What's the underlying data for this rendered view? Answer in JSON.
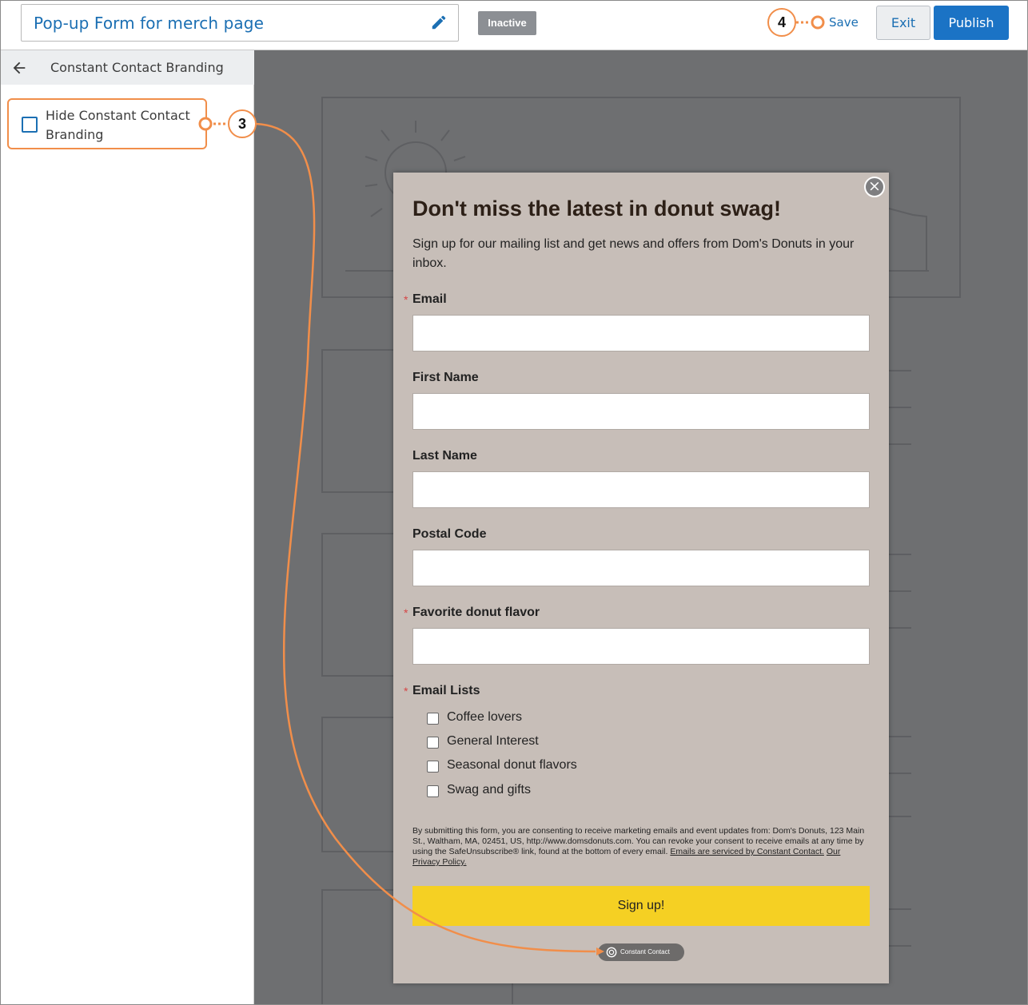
{
  "header": {
    "form_title": "Pop-up Form for merch page",
    "status": "Inactive",
    "save_label": "Save",
    "exit_label": "Exit",
    "publish_label": "Publish"
  },
  "sidebar": {
    "title": "Constant Contact Branding",
    "option_label": "Hide Constant Contact Branding",
    "option_checked": false
  },
  "popup": {
    "title": "Don't miss the latest in donut swag!",
    "description": "Sign up for our mailing list and get news and offers from Dom's Donuts in your inbox.",
    "required_marker": "*",
    "fields": [
      {
        "label": "Email",
        "required": true,
        "value": ""
      },
      {
        "label": "First Name",
        "required": false,
        "value": ""
      },
      {
        "label": "Last Name",
        "required": false,
        "value": ""
      },
      {
        "label": "Postal Code",
        "required": false,
        "value": ""
      },
      {
        "label": "Favorite donut flavor",
        "required": true,
        "value": ""
      }
    ],
    "lists_label": "Email Lists",
    "lists": [
      {
        "label": "Coffee lovers",
        "checked": false
      },
      {
        "label": "General Interest",
        "checked": false
      },
      {
        "label": "Seasonal donut flavors",
        "checked": false
      },
      {
        "label": "Swag and gifts",
        "checked": false
      }
    ],
    "consent_text": "By submitting this form, you are consenting to receive marketing emails and event updates from: Dom's Donuts, 123 Main St., Waltham, MA, 02451, US, http://www.domsdonuts.com. You can revoke your consent to receive emails at any time by using the SafeUnsubscribe® link, found at the bottom of every email.",
    "consent_link1": "Emails are serviced by Constant Contact.",
    "consent_link2": "Our Privacy Policy.",
    "signup_label": "Sign up!",
    "close_glyph": "×",
    "branding_badge": "Constant Contact"
  },
  "annotations": {
    "step3": "3",
    "step4": "4",
    "color": "#f18e4a"
  },
  "colors": {
    "accent": "#1b6fb3",
    "publish": "#1b73c5",
    "canvas": "#6e6f71",
    "popup_bg": "#c7beb8",
    "signup": "#f5d023"
  }
}
